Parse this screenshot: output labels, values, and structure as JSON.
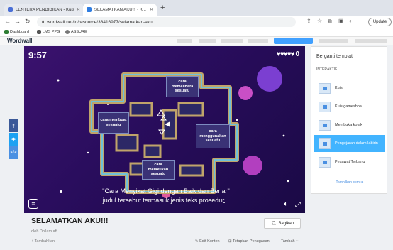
{
  "browser": {
    "tabs": [
      {
        "label": "LENTERA PENDIDIKAN - Kuis",
        "color": "#4a6fd6"
      },
      {
        "label": "SELAMATKAN AKU!!! - K...",
        "color": "#2f7de1"
      }
    ],
    "new_tab": "+",
    "url": "wordwall.net/id/resource/38416977/selamatkan-aku",
    "update_label": "Update",
    "bookmarks": [
      "Dashboard",
      "LMS PPG",
      "ASSURE"
    ]
  },
  "site": {
    "logo": "Wordwall"
  },
  "game": {
    "timer": "9:57",
    "lives": "♥♥♥♥♥",
    "lives_count": "0",
    "boxes": {
      "top": "cara memelihara sesuatu",
      "left": "cara membuat sesuatu",
      "right": "cara menggunakan sesuatu",
      "bottom": "cara melakukan sesuatu"
    },
    "caption_line1": "\"Cara Menyikat Gigi dengan Baik dan Benar\"",
    "caption_line2": "judul tersebut termasuk jenis teks prosedur..."
  },
  "activity": {
    "title": "SELAMATKAN AKU!!!",
    "author": "oleh Dhilamurff",
    "embed": "+ Tambahkan",
    "share_label": "Bagikan",
    "actions": [
      "Edit Konten",
      "Tetapkan Penugasan",
      "Tambah ~"
    ]
  },
  "panel": {
    "title": "Berganti templat",
    "section": "INTERAKTIF",
    "items": [
      {
        "label": "Kuis",
        "active": false
      },
      {
        "label": "Kuis gameshow",
        "active": false
      },
      {
        "label": "Membuka kotak",
        "active": false
      },
      {
        "label": "Pengejaran dalam labirin",
        "active": true
      },
      {
        "label": "Pesawat Terbang",
        "active": false
      }
    ],
    "show_all": "Tampilkan semua"
  },
  "colors": {
    "accent": "#42b4ff",
    "facebook": "#3b5998",
    "twitter": "#1da1f2",
    "embed": "#4a90e2",
    "game_bg": "#2a0d5e"
  }
}
